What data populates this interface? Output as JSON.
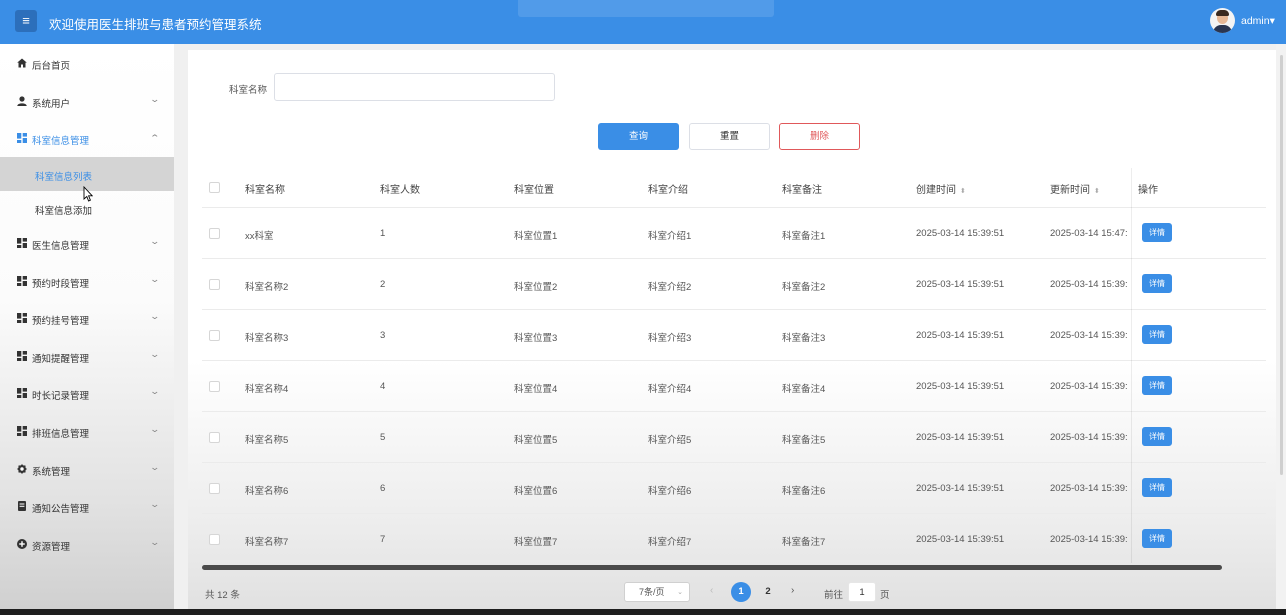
{
  "header": {
    "menu_icon": "hamburger-icon",
    "title": "欢迎使用医生排班与患者预约管理系统",
    "user": "admin",
    "user_chevron": "▾",
    "brand_color": "#3a8ee6"
  },
  "sidebar": {
    "items": [
      {
        "label": "后台首页",
        "icon": "home-icon"
      },
      {
        "label": "系统用户",
        "icon": "user-icon"
      },
      {
        "label": "科室信息管理",
        "icon": "grid-icon"
      },
      {
        "label": "医生信息管理",
        "icon": "grid-icon"
      },
      {
        "label": "预约时段管理",
        "icon": "grid-icon"
      },
      {
        "label": "预约挂号管理",
        "icon": "grid-icon"
      },
      {
        "label": "通知提醒管理",
        "icon": "grid-icon"
      },
      {
        "label": "时长记录管理",
        "icon": "grid-icon"
      },
      {
        "label": "排班信息管理",
        "icon": "grid-icon"
      },
      {
        "label": "系统管理",
        "icon": "gear-icon"
      },
      {
        "label": "通知公告管理",
        "icon": "document-icon"
      },
      {
        "label": "资源管理",
        "icon": "plus-circle-icon"
      }
    ],
    "subitems": [
      {
        "label": "科室信息列表"
      },
      {
        "label": "科室信息添加"
      }
    ]
  },
  "search": {
    "label": "科室名称",
    "value": "",
    "query_label": "查询",
    "reset_label": "重置",
    "delete_label": "删除"
  },
  "table": {
    "headers": {
      "name": "科室名称",
      "count": "科室人数",
      "location": "科室位置",
      "intro": "科室介绍",
      "remark": "科室备注",
      "created": "创建时间",
      "updated": "更新时间",
      "ops": "操作"
    },
    "sort_icon": "⬍",
    "detail_label": "详情",
    "rows": [
      {
        "name": "xx科室",
        "count": "1",
        "location": "科室位置1",
        "intro": "科室介绍1",
        "remark": "科室备注1",
        "created": "2025-03-14 15:39:51",
        "updated": "2025-03-14 15:47:"
      },
      {
        "name": "科室名称2",
        "count": "2",
        "location": "科室位置2",
        "intro": "科室介绍2",
        "remark": "科室备注2",
        "created": "2025-03-14 15:39:51",
        "updated": "2025-03-14 15:39:"
      },
      {
        "name": "科室名称3",
        "count": "3",
        "location": "科室位置3",
        "intro": "科室介绍3",
        "remark": "科室备注3",
        "created": "2025-03-14 15:39:51",
        "updated": "2025-03-14 15:39:"
      },
      {
        "name": "科室名称4",
        "count": "4",
        "location": "科室位置4",
        "intro": "科室介绍4",
        "remark": "科室备注4",
        "created": "2025-03-14 15:39:51",
        "updated": "2025-03-14 15:39:"
      },
      {
        "name": "科室名称5",
        "count": "5",
        "location": "科室位置5",
        "intro": "科室介绍5",
        "remark": "科室备注5",
        "created": "2025-03-14 15:39:51",
        "updated": "2025-03-14 15:39:"
      },
      {
        "name": "科室名称6",
        "count": "6",
        "location": "科室位置6",
        "intro": "科室介绍6",
        "remark": "科室备注6",
        "created": "2025-03-14 15:39:51",
        "updated": "2025-03-14 15:39:"
      },
      {
        "name": "科室名称7",
        "count": "7",
        "location": "科室位置7",
        "intro": "科室介绍7",
        "remark": "科室备注7",
        "created": "2025-03-14 15:39:51",
        "updated": "2025-03-14 15:39:"
      }
    ]
  },
  "pagination": {
    "total": "共 12 条",
    "page_size": "7条/页",
    "pages": [
      "1",
      "2"
    ],
    "current": "1",
    "goto_label": "前往",
    "goto_value": "1",
    "page_suffix": "页",
    "prev": "‹",
    "next": "›"
  }
}
